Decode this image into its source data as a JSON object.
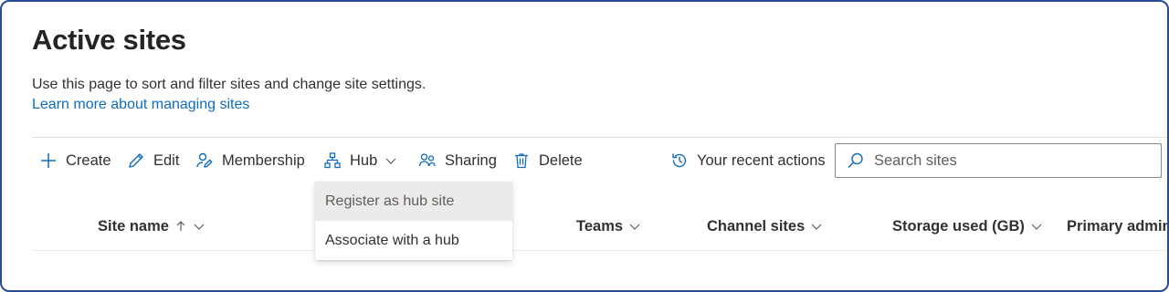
{
  "page": {
    "title": "Active sites",
    "description": "Use this page to sort and filter sites and change site settings.",
    "learn_link": "Learn more about managing sites"
  },
  "toolbar": {
    "create": "Create",
    "edit": "Edit",
    "membership": "Membership",
    "hub": "Hub",
    "sharing": "Sharing",
    "delete": "Delete",
    "recent_actions": "Your recent actions"
  },
  "search": {
    "placeholder": "Search sites",
    "value": ""
  },
  "hub_menu": {
    "items": [
      {
        "label": "Register as hub site",
        "highlighted": true
      },
      {
        "label": "Associate with a hub",
        "highlighted": false
      }
    ]
  },
  "columns": {
    "site_name": "Site name",
    "teams": "Teams",
    "channel_sites": "Channel sites",
    "storage_used": "Storage used (GB)",
    "primary_admin": "Primary admin"
  },
  "colors": {
    "accent": "#0f6cbd",
    "frame_border": "#2b4a9a",
    "text": "#323130"
  }
}
